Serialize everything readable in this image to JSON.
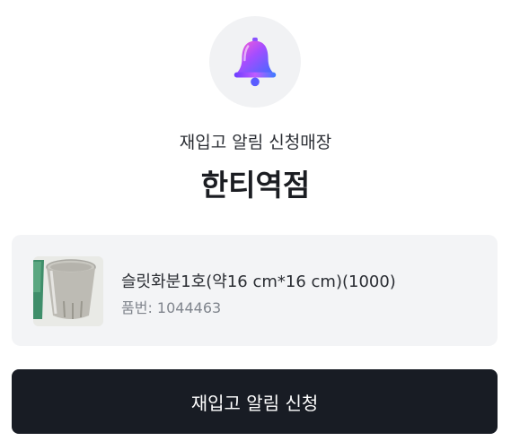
{
  "header": {
    "icon": "bell-icon",
    "subtitle": "재입고 알림 신청매장",
    "store_name": "한티역점"
  },
  "product": {
    "image": "flower-pot-image",
    "name": "슬릿화분1호(약16 cm*16 cm)(1000)",
    "code": "품번: 1044463"
  },
  "actions": {
    "notify_label": "재입고 알림 신청"
  },
  "colors": {
    "button_bg": "#181c24",
    "card_bg": "#f3f4f6",
    "icon_circle_bg": "#f1f2f4"
  }
}
